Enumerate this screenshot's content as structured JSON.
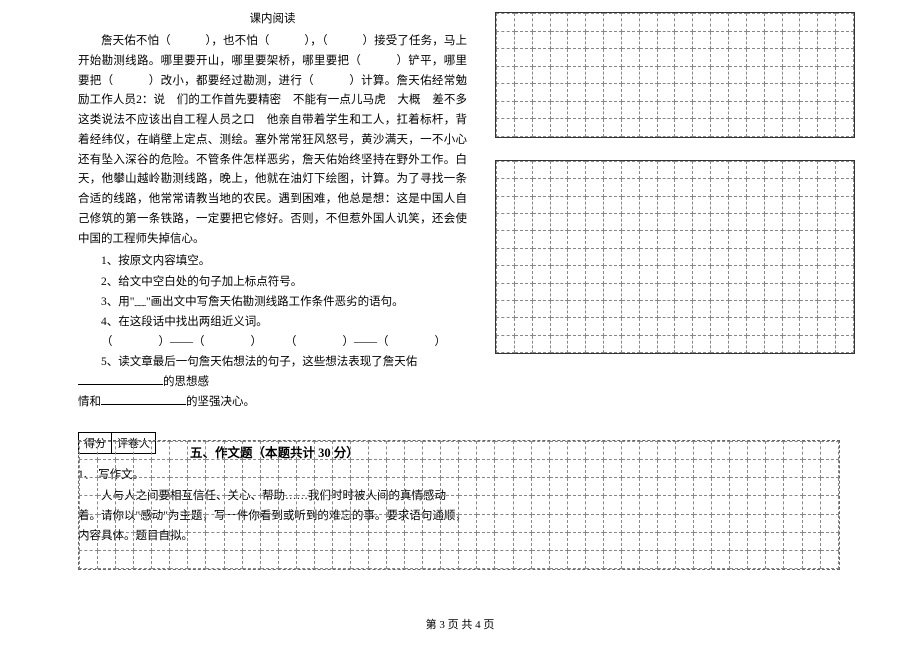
{
  "reading": {
    "title": "课内阅读",
    "passage": "詹天佑不怕（　　　），也不怕（　　　），（　　　）接受了任务，马上开始勘测线路。哪里要开山，哪里要架桥，哪里要把（　　　）铲平，哪里要把（　　　）改小，都要经过勘测，进行（　　　）计算。詹天佑经常勉励工作人员2：说　们的工作首先要精密　不能有一点儿马虎　大概　差不多　这类说法不应该出自工程人员之口　他亲自带着学生和工人，扛着标杆，背着经纬仪，在峭壁上定点、测绘。塞外常常狂风怒号，黄沙满天，一不小心还有坠入深谷的危险。不管条件怎样恶劣，詹天佑始终坚持在野外工作。白天，他攀山越岭勘测线路，晚上，他就在油灯下绘图，计算。为了寻找一条合适的线路，他常常请教当地的农民。遇到困难，他总是想：这是中国人自己修筑的第一条铁路，一定要把它修好。否则，不但惹外国人讥笑，还会使中国的工程师失掉信心。"
  },
  "questions": {
    "q1": "1、按原文内容填空。",
    "q2": "2、给文中空白处的句子加上标点符号。",
    "q3": "3、用\"﹏\"画出文中写詹天佑勘测线路工作条件恶劣的语句。",
    "q4": "4、在这段话中找出两组近义词。",
    "q4_pattern": "（　　　　）——（　　　　）　　　（　　　　）——（　　　　）",
    "q5a": "5、读文章最后一句詹天佑想法的句子，这些想法表现了詹天佑",
    "q5a_tail": "的思想感",
    "q5b": "情和",
    "q5b_tail": "的坚强决心。"
  },
  "score": {
    "col1": "得分",
    "col2": "评卷人"
  },
  "section5": {
    "title": "五、作文题（本题共计 30 分）",
    "q_num": "1、 写作文。",
    "prompt": "人与人之间要相互信任、关心、帮助……我们时时被人间的真情感动着。请你以\"感动\"为主题，写一件你看到或听到的难忘的事。要求语句通顺，内容具体。题目自拟。"
  },
  "footer": "第 3 页 共 4 页"
}
